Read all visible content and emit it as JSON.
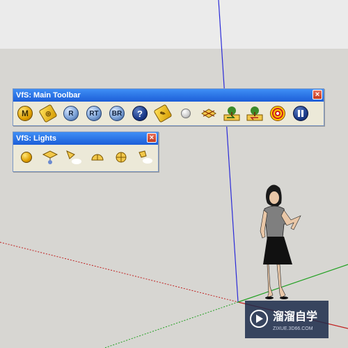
{
  "main_toolbar": {
    "title": "VfS: Main Toolbar",
    "close_symbol": "×",
    "buttons": [
      {
        "label": "M",
        "icon": "m-badge-icon"
      },
      {
        "label": "",
        "icon": "tag-icon"
      },
      {
        "label": "R",
        "icon": "r-badge-icon"
      },
      {
        "label": "RT",
        "icon": "rt-badge-icon"
      },
      {
        "label": "BR",
        "icon": "br-badge-icon"
      },
      {
        "label": "?",
        "icon": "help-icon"
      },
      {
        "label": "",
        "icon": "tag-edit-icon"
      },
      {
        "label": "",
        "icon": "sphere-icon"
      },
      {
        "label": "",
        "icon": "plane-icon"
      },
      {
        "label": "",
        "icon": "tree-folder-open-icon"
      },
      {
        "label": "",
        "icon": "tree-folder-save-icon"
      },
      {
        "label": "",
        "icon": "target-icon"
      },
      {
        "label": "",
        "icon": "pause-icon"
      }
    ]
  },
  "lights_toolbar": {
    "title": "VfS: Lights",
    "close_symbol": "×",
    "buttons": [
      {
        "icon": "omni-light-icon"
      },
      {
        "icon": "area-light-icon"
      },
      {
        "icon": "spot-light-icon"
      },
      {
        "icon": "dome-light-icon"
      },
      {
        "icon": "sphere-light-icon"
      },
      {
        "icon": "ies-light-icon"
      }
    ]
  },
  "watermark": {
    "brand": "溜溜自学",
    "url": "ZIXUE.3D66.COM"
  },
  "colors": {
    "sky": "#ebebeb",
    "ground": "#d7d6d2",
    "title_bar": "#2166e0",
    "toolbar_bg": "#ece9d8",
    "axis_blue": "#2a2ad8",
    "axis_red": "#c02020",
    "axis_green": "#20a020"
  }
}
